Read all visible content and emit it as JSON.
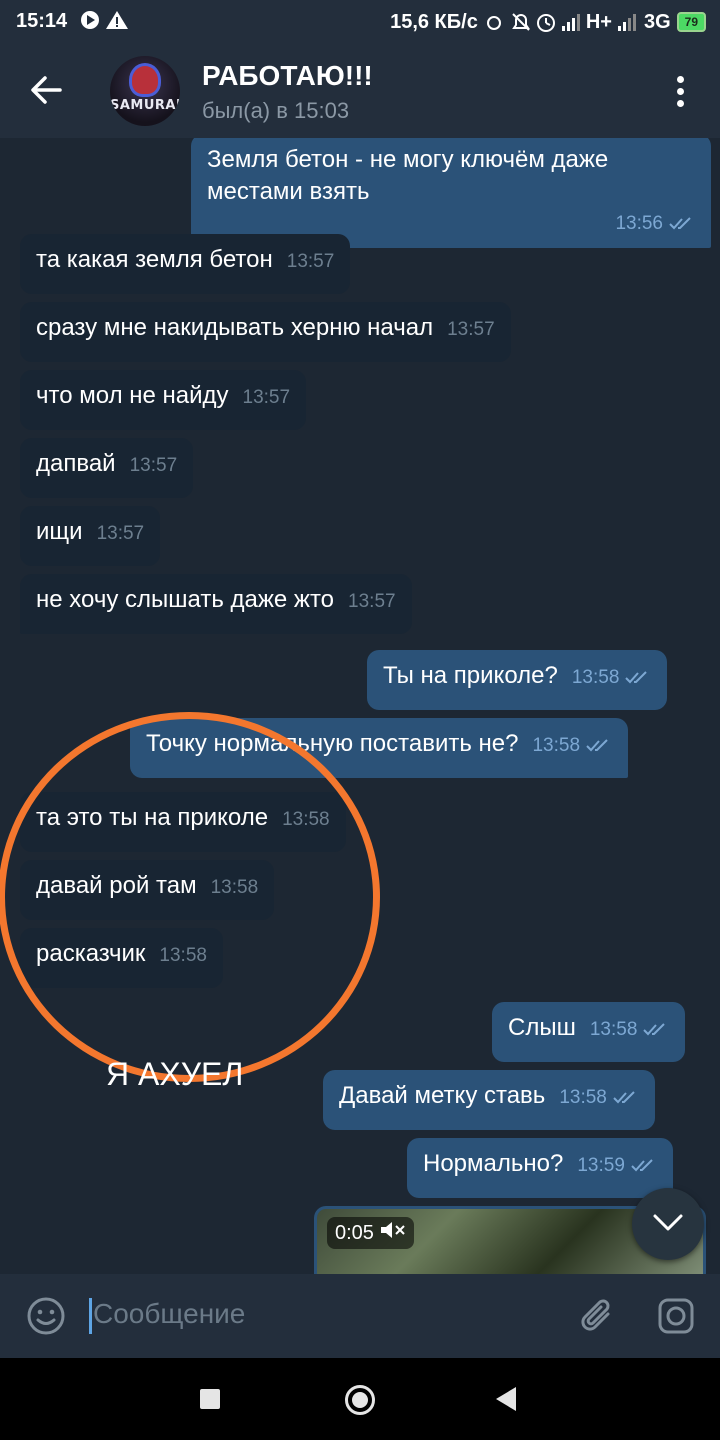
{
  "status_bar": {
    "time": "15:14",
    "network_speed": "15,6 КБ/с",
    "network_type_1": "H+",
    "network_type_2": "3G",
    "battery": "79"
  },
  "header": {
    "title": "РАБОТАЮ!!!",
    "status": "был(а) в 15:03",
    "avatar_text": "SAMURAI"
  },
  "messages": [
    {
      "dir": "out",
      "text": "Земля бетон - не могу ключём даже местами взять",
      "time": "13:56"
    },
    {
      "dir": "in",
      "text": "та какая земля бетон",
      "time": "13:57"
    },
    {
      "dir": "in",
      "text": "сразу мне накидывать херню начал",
      "time": "13:57"
    },
    {
      "dir": "in",
      "text": "что мол не найду",
      "time": "13:57"
    },
    {
      "dir": "in",
      "text": "дапвай",
      "time": "13:57"
    },
    {
      "dir": "in",
      "text": "ищи",
      "time": "13:57"
    },
    {
      "dir": "in",
      "text": "не хочу слышать даже жто",
      "time": "13:57"
    },
    {
      "dir": "out",
      "text": "Ты на приколе?",
      "time": "13:58"
    },
    {
      "dir": "out",
      "text": "Точку нормальную поставить не?",
      "time": "13:58"
    },
    {
      "dir": "in",
      "text": "та это ты на приколе",
      "time": "13:58"
    },
    {
      "dir": "in",
      "text": "давай рой там",
      "time": "13:58"
    },
    {
      "dir": "in",
      "text": "расказчик",
      "time": "13:58"
    },
    {
      "dir": "out",
      "text": "Слыш",
      "time": "13:58"
    },
    {
      "dir": "out",
      "text": "Давай метку ставь",
      "time": "13:58"
    },
    {
      "dir": "out",
      "text": "Нормально?",
      "time": "13:59"
    }
  ],
  "annotation": {
    "text": "Я АХУЕЛ",
    "color": "#f4772e"
  },
  "video": {
    "duration": "0:05",
    "muted_icon": "muted-speaker-icon"
  },
  "input": {
    "placeholder": "Сообщение"
  },
  "colors": {
    "background": "#1d2733",
    "incoming": "#182533",
    "outgoing": "#2b5278",
    "header": "#232e3c"
  }
}
